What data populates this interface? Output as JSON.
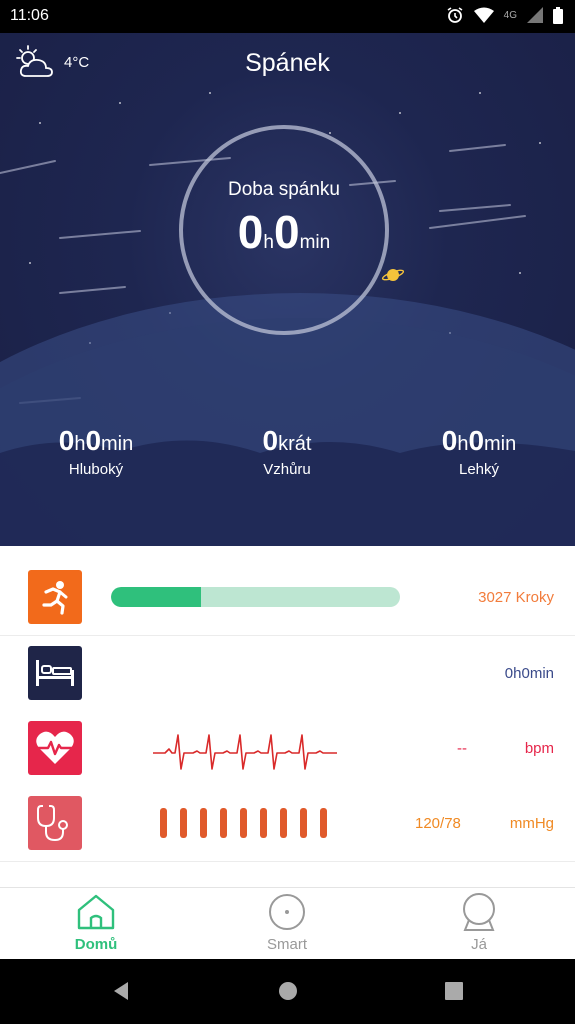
{
  "status_bar": {
    "time": "11:06",
    "network": "4G"
  },
  "weather": {
    "temperature": "4°C",
    "icon": "partly-cloudy-icon"
  },
  "header": {
    "title": "Spánek"
  },
  "sleep": {
    "label": "Doba spánku",
    "hours": "0",
    "hours_unit": "h",
    "minutes": "0",
    "minutes_unit": "min"
  },
  "stats": [
    {
      "h": "0",
      "h_unit": "h",
      "m": "0",
      "m_unit": "min",
      "label": "Hluboký"
    },
    {
      "count": "0",
      "count_unit": "krát",
      "label": "Vzhůru"
    },
    {
      "h": "0",
      "h_unit": "h",
      "m": "0",
      "m_unit": "min",
      "label": "Lehký"
    }
  ],
  "rows": {
    "steps": {
      "value": "3027 Kroky",
      "progress": 0.31,
      "color": "#f27c3b",
      "icon": "running-icon"
    },
    "sleep": {
      "value": "0h0min",
      "color": "#3a4a8a",
      "icon": "bed-icon"
    },
    "heart": {
      "value": "--",
      "unit": "bpm",
      "color": "#e6264b",
      "icon": "heart-pulse-icon"
    },
    "blood_pressure": {
      "value": "120/78",
      "unit": "mmHg",
      "color": "#f08a24",
      "icon": "stethoscope-icon"
    }
  },
  "bottom_nav": [
    {
      "label": "Domů",
      "icon": "home-icon",
      "active": true
    },
    {
      "label": "Smart",
      "icon": "smart-icon",
      "active": false
    },
    {
      "label": "Já",
      "icon": "profile-icon",
      "active": false
    }
  ],
  "colors": {
    "accent": "#2fc07c",
    "hero_bg": "#1e2650"
  }
}
